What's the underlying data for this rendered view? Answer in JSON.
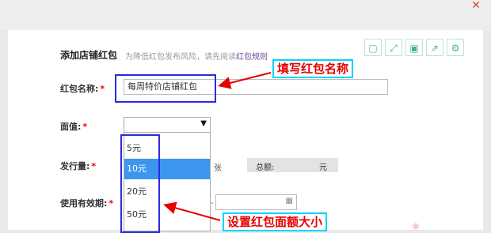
{
  "form": {
    "title": "添加店铺红包",
    "subtitle_prefix": "为降低红包发布风险，请先阅读",
    "rules_link": "红包规则",
    "name_label": "红包名称:",
    "name_value": "每周特价店铺红包",
    "face_value_label": "面值:",
    "issue_count_label": "发行量:",
    "count_unit": "张",
    "total_label": "总额:",
    "total_unit": "元",
    "validity_label": "使用有效期:",
    "validity_separator": "-",
    "required_mark": "*"
  },
  "dropdown": {
    "selected": "10元",
    "options": [
      "5元",
      "10元",
      "20元",
      "50元"
    ]
  },
  "annotations": {
    "name_callout": "填写红包名称",
    "value_callout": "设置红包面额大小"
  },
  "colors": {
    "annotation_text": "#e60000",
    "callout_border": "#00d4ff",
    "highlight_box": "#2a2ae0",
    "selected_option": "#3c96ee",
    "tool_icon": "#45b38d"
  },
  "icons": [
    "close-icon",
    "copy-icon",
    "expand-icon",
    "save-icon",
    "share-icon",
    "gear-icon",
    "calendar-icon",
    "dropdown-arrow-icon"
  ]
}
